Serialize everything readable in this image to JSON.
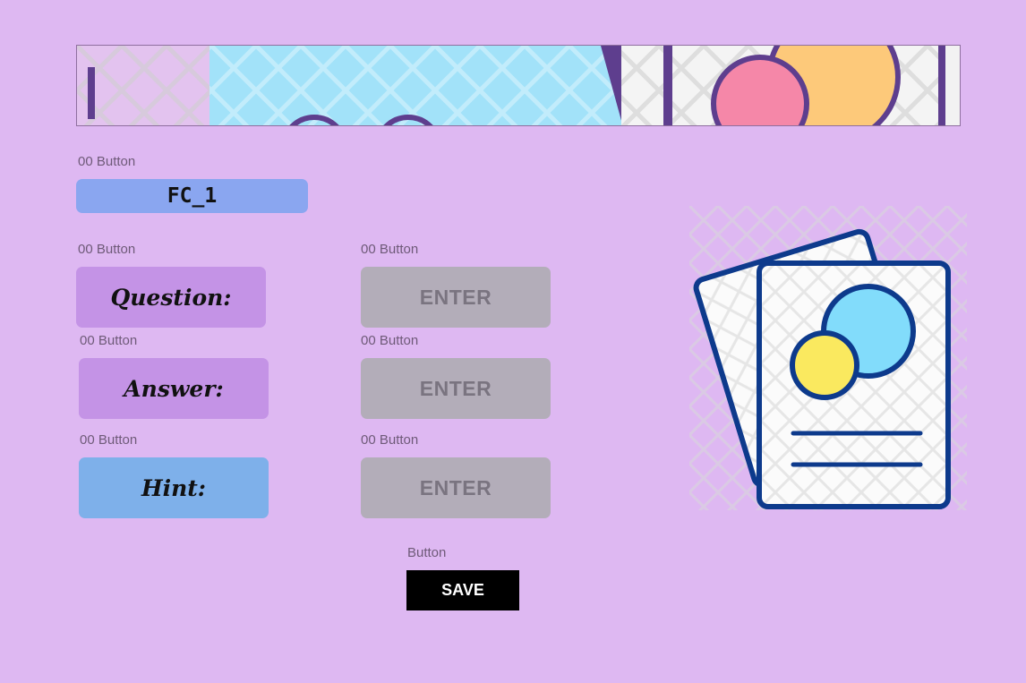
{
  "header": {
    "banner_icon": "flashcards-banner-image"
  },
  "title_group": {
    "caption": "00 Button",
    "label": "FC_1"
  },
  "fields": [
    {
      "caption": "00 Button",
      "label": "Question:",
      "input_caption": "00 Button",
      "input_label": "ENTER"
    },
    {
      "caption": "00 Button",
      "label": "Answer:",
      "input_caption": "00 Button",
      "input_label": "ENTER"
    },
    {
      "caption": "00 Button",
      "label": "Hint:",
      "input_caption": "00 Button",
      "input_label": "ENTER"
    }
  ],
  "save": {
    "caption": "Button",
    "label": "SAVE"
  },
  "illustration": {
    "icon": "flashcards-icon"
  },
  "colors": {
    "background": "#deb8f2",
    "title_button": "#8aa6f0",
    "label_purple": "#c493e6",
    "label_blue": "#7eb0ea",
    "enter_button": "#b3adb9",
    "save_button": "#000000",
    "icon_outline": "#0d3a8c"
  }
}
